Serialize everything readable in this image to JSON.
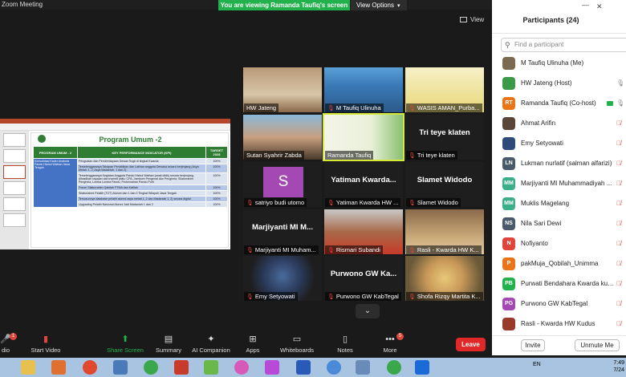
{
  "window": {
    "title": "Zoom Meeting"
  },
  "banner": {
    "sharing": "You are viewing Ramanda Taufiq's screen",
    "view_options": "View Options"
  },
  "view_button": {
    "label": "View"
  },
  "slide": {
    "title": "Program Umum -2",
    "headers": [
      "PROGRAM UMUM - 2",
      "KEY PERFORMANCE INDICATOR (KPI)",
      "TARGET 2028"
    ],
    "program": "Konsolidasi Kader Anakota Pandu Hizbul Wathan Jawa Tengah",
    "rows": [
      {
        "kpi": "Penguatan dan Pemberdayaan Dewan Sugli di tingkat Kwarda",
        "target": "100%"
      },
      {
        "kpi": "Terselenggaranya Tahapan Pendidikan dan Latihan anggota Dewasa secara berjenjang (Asya Melati: 1, 2; Asya Madaniah: 1 dan 2)",
        "target": "100%"
      },
      {
        "kpi": "Terselenggaranya Kegiatan Anggota Pandu Hizbul Wathan (anak didik) secara berjenjang, dihasilkan capaian dan insentif yaitu: CPA, Jambore Pengenal dan Penghela, Silaturrahim Penghela, Lomba Lomba Pandu, Perkemahan Pandu Putri",
        "target": "100%"
      },
      {
        "kpi": "Forum Silaturrahim Qabilah PTMA dan Kafilah",
        "target": "100%"
      },
      {
        "kpi": "Silaturrahmi Pelatih (TOT) Alumni dan 1 dan 2 Tingkat Wilayah Jawa Tengah",
        "target": "100%"
      },
      {
        "kpi": "Tersusunnya database pelatih alumni asya melati 1, 2 dan Madaniah 1, 2) secara digital",
        "target": "100%"
      },
      {
        "kpi": "Upgrading Pelatih Nasional Alumni Jadi Madaniah 1 dan 2",
        "target": "100%"
      }
    ]
  },
  "tiles": [
    {
      "name": "HW Jateng",
      "muted": false,
      "big_name": ""
    },
    {
      "name": "M Taufiq Ulinuha",
      "muted": false,
      "big_name": ""
    },
    {
      "name": "WASIS AMAN_Purba...",
      "muted": true,
      "big_name": ""
    },
    {
      "name": "Sutan Syahrir Zabda",
      "muted": false,
      "big_name": ""
    },
    {
      "name": "Ramanda Taufiq",
      "muted": false,
      "big_name": ""
    },
    {
      "name": "Tri teye klaten",
      "muted": true,
      "big_name": "Tri teye klaten"
    },
    {
      "name": "satriyo budi utomo",
      "muted": true,
      "big_name": ""
    },
    {
      "name": "Yatiman Kwarda HW ...",
      "muted": true,
      "big_name": "Yatiman  Kwarda..."
    },
    {
      "name": "Slamet Widodo",
      "muted": true,
      "big_name": "Slamet Widodo"
    },
    {
      "name": "Marjiyanti MI Muham...",
      "muted": true,
      "big_name": "Marjiyanti MI M..."
    },
    {
      "name": "Rismari Subandi",
      "muted": true,
      "big_name": ""
    },
    {
      "name": "Rasli - Kwarda HW K...",
      "muted": true,
      "big_name": ""
    },
    {
      "name": "Emy Setyowati",
      "muted": true,
      "big_name": ""
    },
    {
      "name": "Purwono GW KabTegal",
      "muted": true,
      "big_name": "Purwono GW Ka..."
    },
    {
      "name": "Shofa Rizqy Martita K...",
      "muted": true,
      "big_name": ""
    }
  ],
  "satriyo_initial": "S",
  "participants_panel": {
    "title": "Participants (24)",
    "search_placeholder": "Find a participant",
    "invite": "Invite",
    "unmute_me": "Unmute Me",
    "items": [
      {
        "name": "M Taufiq Ulinuha (Me)",
        "initials": "",
        "color": "#7a6a4f",
        "mic": "none"
      },
      {
        "name": "HW Jateng (Host)",
        "initials": "",
        "color": "#3a9a4a",
        "mic": "on"
      },
      {
        "name": "Ramanda Taufiq (Co-host)",
        "initials": "RT",
        "color": "#e8751a",
        "mic": "on"
      },
      {
        "name": "Ahmat Arifin",
        "initials": "",
        "color": "#5a4636",
        "mic": "muted"
      },
      {
        "name": "Emy Setyowati",
        "initials": "",
        "color": "#2d4a7a",
        "mic": "muted"
      },
      {
        "name": "Lukman nurlatif (salman alfarizi)",
        "initials": "LN",
        "color": "#4a5a6a",
        "mic": "muted"
      },
      {
        "name": "Marjiyanti MI Muhammadiyah ...",
        "initials": "MM",
        "color": "#3cae8a",
        "mic": "muted"
      },
      {
        "name": "Muklis Magelang",
        "initials": "MM",
        "color": "#3cae8a",
        "mic": "muted"
      },
      {
        "name": "Nila Sari Dewi",
        "initials": "NS",
        "color": "#4a5a6a",
        "mic": "muted"
      },
      {
        "name": "Nofiyanto",
        "initials": "N",
        "color": "#e0453c",
        "mic": "muted"
      },
      {
        "name": "pakMuja_Qobilah_Unimma",
        "initials": "P",
        "color": "#e8751a",
        "mic": "muted"
      },
      {
        "name": "Purwati Bendahara Kwarda kud...",
        "initials": "PB",
        "color": "#22b14c",
        "mic": "muted"
      },
      {
        "name": "Purwono GW KabTegal",
        "initials": "PG",
        "color": "#a449b4",
        "mic": "muted"
      },
      {
        "name": "Rasli - Kwarda HW Kudus",
        "initials": "",
        "color": "#9a3a2a",
        "mic": "muted"
      }
    ]
  },
  "toolbar": {
    "audio": "dio",
    "video": "Start Video",
    "share": "Share Screen",
    "summary": "Summary",
    "ai": "AI Companion",
    "apps": "Apps",
    "whiteboards": "Whiteboards",
    "notes": "Notes",
    "more": "More",
    "more_badge": "5",
    "audio_badge": "1",
    "leave": "Leave"
  },
  "taskbar": {
    "lang": "EN",
    "time": "7:49",
    "date": "7/24"
  },
  "colors": {
    "green": "#22b14c",
    "leave": "#e02828",
    "muted": "#e0453c"
  }
}
